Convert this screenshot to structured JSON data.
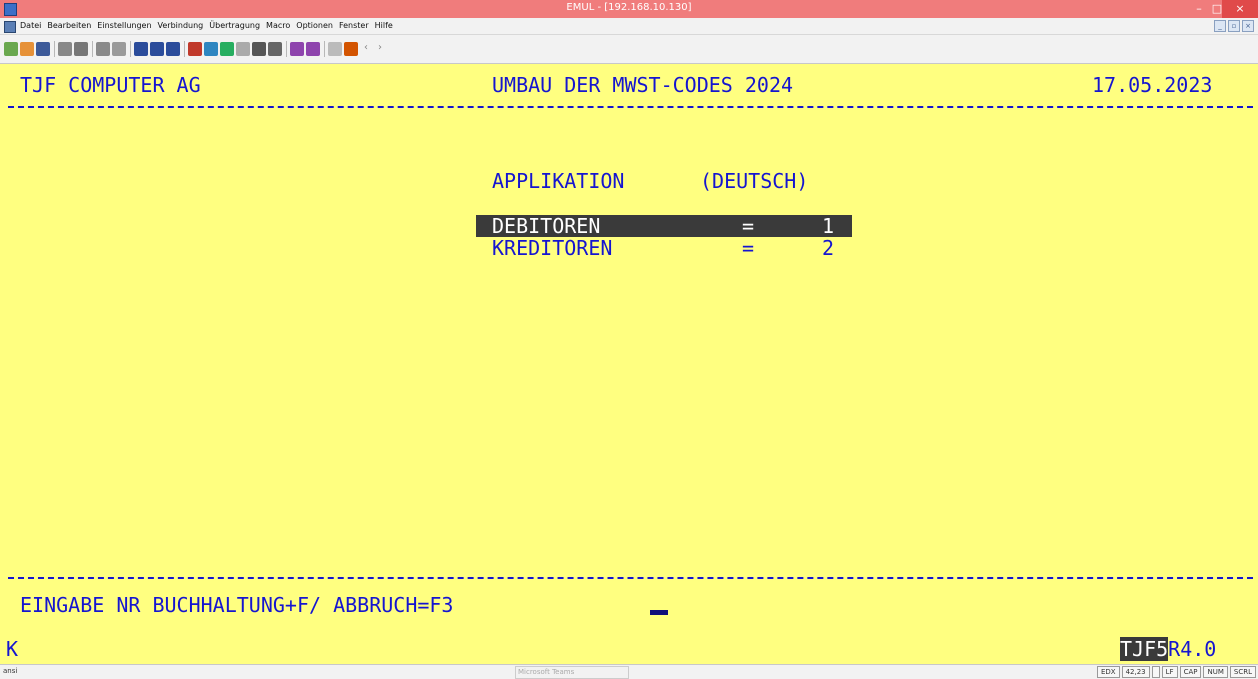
{
  "window": {
    "title": "EMUL - [192.168.10.130]",
    "controls": {
      "minimize": "–",
      "maximize": "□",
      "close": "×"
    }
  },
  "menu": {
    "items": [
      "Datei",
      "Bearbeiten",
      "Einstellungen",
      "Verbindung",
      "Übertragung",
      "Macro",
      "Optionen",
      "Fenster",
      "Hilfe"
    ],
    "mdi_controls": {
      "minimize": "_",
      "restore": "▫",
      "close": "×"
    }
  },
  "toolbar": {
    "icons": [
      "connect-icon",
      "open-icon",
      "save-icon",
      "print-icon",
      "print-screen-icon",
      "copy-icon",
      "paste-icon",
      "font-size-icon",
      "font-larger-icon",
      "font-smaller-icon",
      "settings-icon",
      "keyboard-icon",
      "colors-icon",
      "macro-icon",
      "transfer-icon",
      "hotspot-icon",
      "printer-setup-icon",
      "printer-icon",
      "display-icon",
      "color-icon"
    ],
    "nav_back": "‹",
    "nav_forward": "›"
  },
  "screen": {
    "company": "TJF COMPUTER AG",
    "program_title": "UMBAU DER MWST-CODES 2024",
    "date": "17.05.2023",
    "section_heading": "APPLIKATION",
    "section_language": "(DEUTSCH)",
    "options": [
      {
        "label": "DEBITOREN",
        "eq": "=",
        "value": "1",
        "selected": true
      },
      {
        "label": "KREDITOREN",
        "eq": "=",
        "value": "2",
        "selected": false
      }
    ],
    "prompt": "EINGABE NR BUCHHALTUNG+F/ ABBRUCH=F3",
    "status_left": "K",
    "status_right_highlight": "TJF5",
    "status_right": "R4.0"
  },
  "statusbar": {
    "left": "ansi",
    "center": "Microsoft Teams",
    "cells": [
      "EDX",
      "42,23",
      "",
      "LF",
      "CAP",
      "NUM",
      "SCRL"
    ]
  },
  "colors": {
    "screen_bg": "#ffff80",
    "screen_text": "#1515d0",
    "highlight_bg": "#3a3a3a",
    "titlebar_bg": "#f07c7c"
  }
}
